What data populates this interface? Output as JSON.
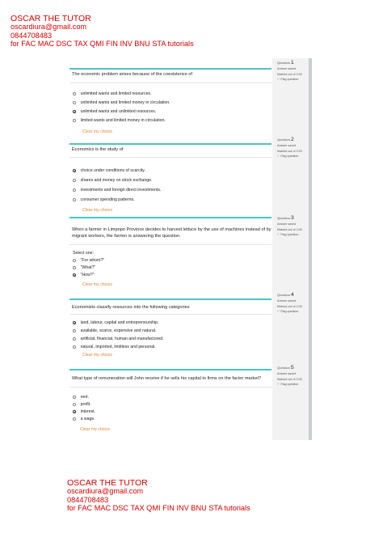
{
  "watermark": {
    "name": "OSCAR THE TUTOR",
    "email": "oscardiura@gmail.com",
    "phone": "0844708483",
    "tagline": "for FAC MAC DSC TAX QMI FIN INV BNU STA tutorials"
  },
  "info": {
    "question_label": "Question",
    "status": "Answer saved",
    "marked": "Marked out of 2.00",
    "flag": "Flag question"
  },
  "clear_label": "Clear my choice",
  "select_one_label": "Select one:",
  "questions": [
    {
      "number": "1",
      "text": "The economic problem arises because of the coexistence of",
      "options": [
        {
          "label": "unlimited wants and limited resources.",
          "selected": false
        },
        {
          "label": "unlimited wants and limited money in circulation.",
          "selected": false
        },
        {
          "label": "unlimited wants and unlimited resources.",
          "selected": true
        },
        {
          "label": "limited wants and limited money in circulation.",
          "selected": false
        }
      ]
    },
    {
      "number": "2",
      "text": "Economics is the study of",
      "options": [
        {
          "label": "choice under conditions of scarcity.",
          "selected": true
        },
        {
          "label": "shares and money on stock exchange.",
          "selected": false
        },
        {
          "label": "investments and foreign direct investments.",
          "selected": false
        },
        {
          "label": "consumer spending patterns.",
          "selected": false
        }
      ]
    },
    {
      "number": "3",
      "text_lines": [
        "When a farmer in Limpopo Province decides to harvest lettuce by the use of machines instead of by",
        "migrant workers, the farmer is answering the question."
      ],
      "options": [
        {
          "label": "\"For whom?\"",
          "selected": false
        },
        {
          "label": "\"What?\"",
          "selected": false
        },
        {
          "label": "\"How?\"",
          "selected": true
        }
      ]
    },
    {
      "number": "4",
      "text": "Economists classify resources into the following categories",
      "options": [
        {
          "label": "land, labour, capital and entrepreneurship.",
          "selected": true
        },
        {
          "label": "available, scarce, expensive and natural.",
          "selected": false
        },
        {
          "label": "artificial, financial, human and manufactured.",
          "selected": false
        },
        {
          "label": "natural, imported, limitless and personal.",
          "selected": false
        }
      ]
    },
    {
      "number": "5",
      "text": "What type of remuneration will John receive if he sells his capital to firms on the factor market?",
      "options": [
        {
          "label": "rent.",
          "selected": false
        },
        {
          "label": "profit.",
          "selected": false
        },
        {
          "label": "interest.",
          "selected": true
        },
        {
          "label": "a wage.",
          "selected": false
        }
      ]
    }
  ]
}
